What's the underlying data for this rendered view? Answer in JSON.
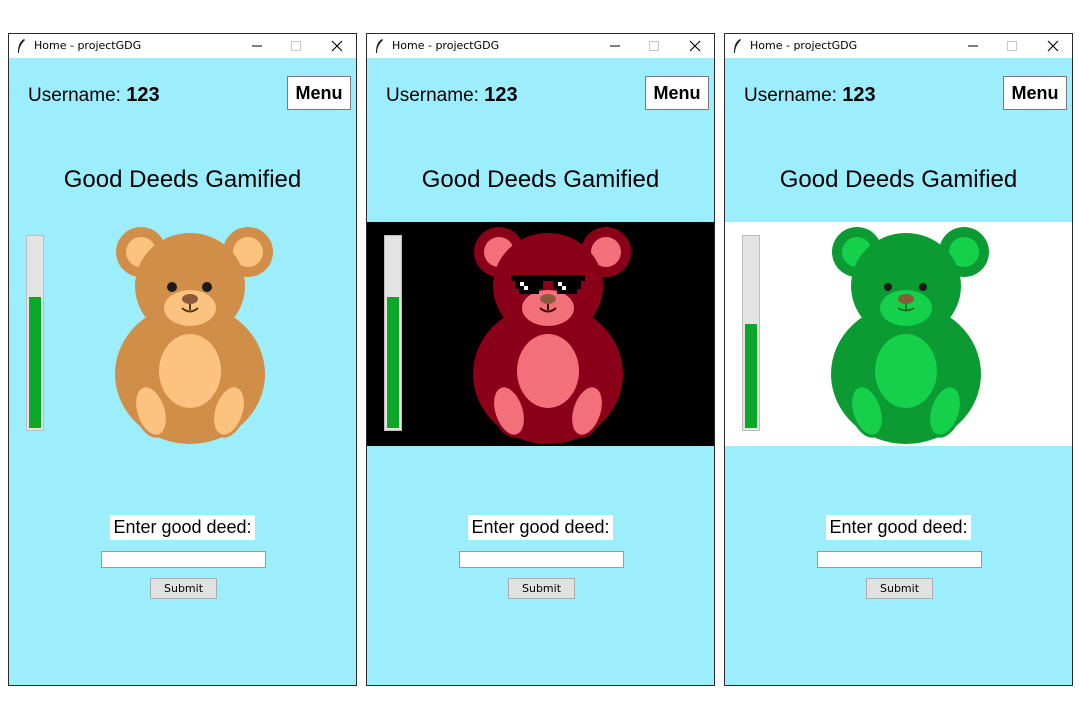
{
  "windows": [
    {
      "title": "Home - projectGDG",
      "username_label": "Username:",
      "username_value": "123",
      "menu_label": "Menu",
      "app_title": "Good Deeds Gamified",
      "progress_fraction": 0.69,
      "bear_theme": "brown",
      "panel_background": "#9deefd",
      "deed_label": "Enter good deed:",
      "deed_input_value": "",
      "submit_label": "Submit"
    },
    {
      "title": "Home - projectGDG",
      "username_label": "Username:",
      "username_value": "123",
      "menu_label": "Menu",
      "app_title": "Good Deeds Gamified",
      "progress_fraction": 0.69,
      "bear_theme": "red-with-sunglasses",
      "panel_background": "#000000",
      "deed_label": "Enter good deed:",
      "deed_input_value": "",
      "submit_label": "Submit"
    },
    {
      "title": "Home - projectGDG",
      "username_label": "Username:",
      "username_value": "123",
      "menu_label": "Menu",
      "app_title": "Good Deeds Gamified",
      "progress_fraction": 0.55,
      "bear_theme": "green",
      "panel_background": "#ffffff",
      "deed_label": "Enter good deed:",
      "deed_input_value": "",
      "submit_label": "Submit"
    }
  ],
  "icons": {
    "app_icon": "feather-icon",
    "minimize": "minimize-icon",
    "maximize": "maximize-icon",
    "close": "close-icon"
  },
  "colors": {
    "client_bg": "#9deefd",
    "progress_fill": "#0ca82a",
    "brown_bear": "#d08e48",
    "red_bear": "#8a0019",
    "green_bear": "#0c9a33"
  }
}
